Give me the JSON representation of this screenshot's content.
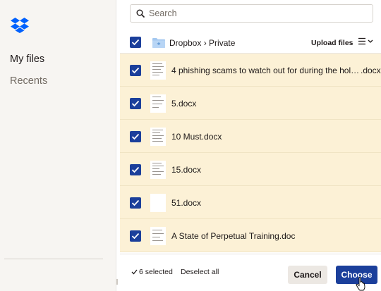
{
  "sidebar": {
    "logo_icon": "dropbox-logo-icon",
    "items": [
      {
        "label": "My files",
        "active": true
      },
      {
        "label": "Recents",
        "active": false
      }
    ]
  },
  "search": {
    "placeholder": "Search",
    "value": "",
    "icon": "search-icon"
  },
  "header": {
    "folder_icon": "shared-folder-icon",
    "breadcrumb": "Dropbox › Private",
    "upload_label": "Upload files",
    "view_icon": "list-view-icon"
  },
  "files": [
    {
      "name": "4 phishing scams to watch out for during the holid…",
      "ext": ".docx",
      "selected": true
    },
    {
      "name": "5.docx",
      "ext": "",
      "selected": true
    },
    {
      "name": "10 Must.docx",
      "ext": "",
      "selected": true
    },
    {
      "name": "15.docx",
      "ext": "",
      "selected": true
    },
    {
      "name": "51.docx",
      "ext": "",
      "selected": true
    },
    {
      "name": "A State of Perpetual Training.doc",
      "ext": "",
      "selected": true
    }
  ],
  "footer": {
    "selected_count": "6 selected",
    "deselect_label": "Deselect all",
    "cancel_label": "Cancel",
    "choose_label": "Choose"
  },
  "colors": {
    "accent": "#1b3f9b",
    "selected_row": "#fcf1d6",
    "sidebar_bg": "#f7f5f2",
    "logo": "#0061fe"
  }
}
